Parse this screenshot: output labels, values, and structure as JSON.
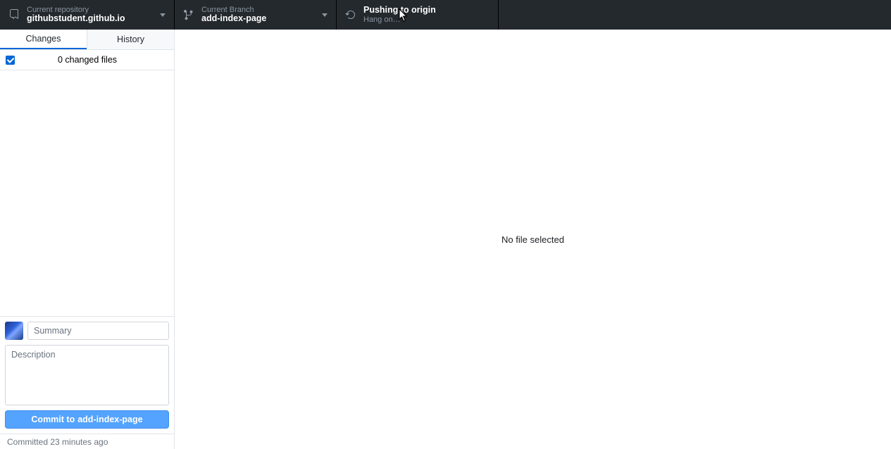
{
  "toolbar": {
    "repo_label": "Current repository",
    "repo_value": "githubstudent.github.io",
    "branch_label": "Current Branch",
    "branch_value": "add-index-page",
    "push_label": "Pushing to origin",
    "push_value": "Hang on…"
  },
  "tabs": {
    "changes": "Changes",
    "history": "History"
  },
  "changes": {
    "count_text": "0 changed files"
  },
  "commit": {
    "summary_placeholder": "Summary",
    "description_placeholder": "Description",
    "button_prefix": "Commit to ",
    "button_branch": "add-index-page"
  },
  "undo": {
    "text": "Committed 23 minutes ago"
  },
  "main": {
    "empty_text": "No file selected"
  }
}
